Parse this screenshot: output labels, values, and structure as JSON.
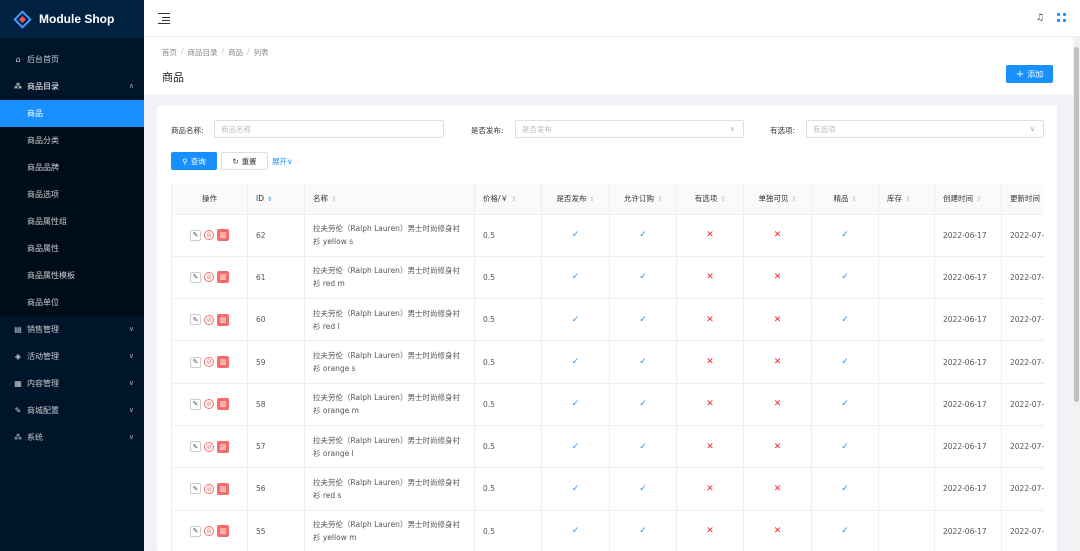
{
  "app": {
    "title": "Module Shop"
  },
  "sidebar": {
    "items": [
      {
        "label": "后台首页",
        "icon": "home-icon",
        "glyph": "⌂"
      },
      {
        "label": "商品目录",
        "icon": "sitemap-icon",
        "glyph": "⁂",
        "open": true,
        "children": [
          "商品",
          "商品分类",
          "商品品牌",
          "商品选项",
          "商品属性组",
          "商品属性",
          "商品属性模板",
          "商品单位"
        ],
        "active_child": 0
      },
      {
        "label": "销售管理",
        "icon": "shop-icon",
        "glyph": "▤"
      },
      {
        "label": "活动管理",
        "icon": "tag-icon",
        "glyph": "◈"
      },
      {
        "label": "内容管理",
        "icon": "document-icon",
        "glyph": "▦"
      },
      {
        "label": "商城配置",
        "icon": "wrench-icon",
        "glyph": "✎"
      },
      {
        "label": "系统",
        "icon": "cluster-icon",
        "glyph": "⁂"
      }
    ]
  },
  "breadcrumb": [
    "首页",
    "商品目录",
    "商品",
    "列表"
  ],
  "page": {
    "title": "商品",
    "add_label": "添加"
  },
  "filters": {
    "name_label": "商品名称:",
    "name_placeholder": "商品名称",
    "published_label": "是否发布:",
    "published_placeholder": "是否发布",
    "options_label": "有选项:",
    "options_placeholder": "有选项",
    "query_label": "查询",
    "reset_label": "重置",
    "expand_label": "展开"
  },
  "table": {
    "columns": [
      "操作",
      "ID",
      "名称",
      "价格/￥",
      "是否发布",
      "允许订购",
      "有选项",
      "单独可见",
      "精品",
      "库存",
      "创建时间",
      "更新时间"
    ],
    "rows": [
      {
        "id": "62",
        "name": "拉夫劳伦（Ralph Lauren）男士时尚修身衬衫 yellow s",
        "price": "0.5",
        "published": true,
        "orderable": true,
        "has_options": false,
        "visible": false,
        "featured": true,
        "stock": "",
        "created": "2022-06-17",
        "updated": "2022-07-"
      },
      {
        "id": "61",
        "name": "拉夫劳伦（Ralph Lauren）男士时尚修身衬衫 red m",
        "price": "0.5",
        "published": true,
        "orderable": true,
        "has_options": false,
        "visible": false,
        "featured": true,
        "stock": "",
        "created": "2022-06-17",
        "updated": "2022-07-"
      },
      {
        "id": "60",
        "name": "拉夫劳伦（Ralph Lauren）男士时尚修身衬衫 red l",
        "price": "0.5",
        "published": true,
        "orderable": true,
        "has_options": false,
        "visible": false,
        "featured": true,
        "stock": "",
        "created": "2022-06-17",
        "updated": "2022-07-"
      },
      {
        "id": "59",
        "name": "拉夫劳伦（Ralph Lauren）男士时尚修身衬衫 orange s",
        "price": "0.5",
        "published": true,
        "orderable": true,
        "has_options": false,
        "visible": false,
        "featured": true,
        "stock": "",
        "created": "2022-06-17",
        "updated": "2022-07-"
      },
      {
        "id": "58",
        "name": "拉夫劳伦（Ralph Lauren）男士时尚修身衬衫 orange m",
        "price": "0.5",
        "published": true,
        "orderable": true,
        "has_options": false,
        "visible": false,
        "featured": true,
        "stock": "",
        "created": "2022-06-17",
        "updated": "2022-07-"
      },
      {
        "id": "57",
        "name": "拉夫劳伦（Ralph Lauren）男士时尚修身衬衫 orange l",
        "price": "0.5",
        "published": true,
        "orderable": true,
        "has_options": false,
        "visible": false,
        "featured": true,
        "stock": "",
        "created": "2022-06-17",
        "updated": "2022-07-"
      },
      {
        "id": "56",
        "name": "拉夫劳伦（Ralph Lauren）男士时尚修身衬衫 red s",
        "price": "0.5",
        "published": true,
        "orderable": true,
        "has_options": false,
        "visible": false,
        "featured": true,
        "stock": "",
        "created": "2022-06-17",
        "updated": "2022-07-"
      },
      {
        "id": "55",
        "name": "拉夫劳伦（Ralph Lauren）男士时尚修身衬衫 yellow m",
        "price": "0.5",
        "published": true,
        "orderable": true,
        "has_options": false,
        "visible": false,
        "featured": true,
        "stock": "",
        "created": "2022-06-17",
        "updated": "2022-07-"
      }
    ]
  },
  "icons": {
    "yes": "check-icon",
    "no": "cross-icon",
    "edit": "edit-icon",
    "disable": "stop-icon",
    "delete": "trash-icon"
  },
  "colors": {
    "primary": "#1890ff",
    "sidebar": "#001529",
    "danger": "#f56c6c"
  }
}
